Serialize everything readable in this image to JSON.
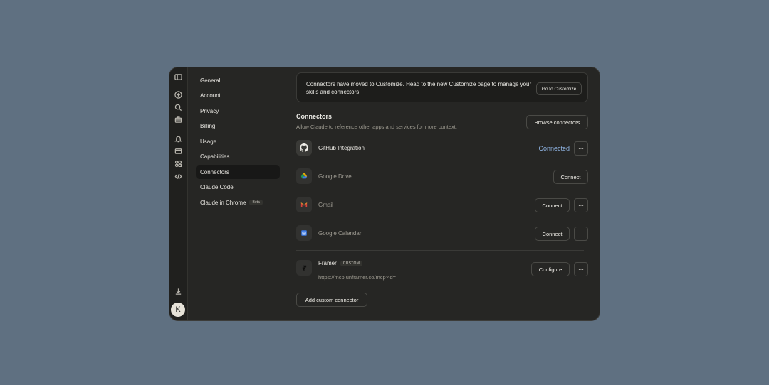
{
  "nav": {
    "items": [
      {
        "label": "General"
      },
      {
        "label": "Account"
      },
      {
        "label": "Privacy"
      },
      {
        "label": "Billing"
      },
      {
        "label": "Usage"
      },
      {
        "label": "Capabilities"
      },
      {
        "label": "Connectors"
      },
      {
        "label": "Claude Code"
      },
      {
        "label": "Claude in Chrome",
        "badge": "Beta"
      }
    ],
    "active": "Connectors"
  },
  "rail": {
    "icons": [
      "sidebar-toggle-icon",
      "new-chat-icon",
      "search-icon",
      "briefcase-icon",
      "bell-icon",
      "archive-icon",
      "apps-icon",
      "code-icon",
      "download-icon"
    ],
    "avatar_initial": "K"
  },
  "notice": {
    "text": "Connectors have moved to Customize. Head to the new Customize page to manage your skills and connectors.",
    "button": "Go to Customize"
  },
  "connectors": {
    "title": "Connectors",
    "subtitle": "Allow Claude to reference other apps and services for more context.",
    "browse_label": "Browse connectors",
    "items": [
      {
        "name": "GitHub Integration",
        "status": "Connected",
        "icon": "github-icon"
      },
      {
        "name": "Google Drive",
        "action": "Connect",
        "icon": "google-drive-icon"
      },
      {
        "name": "Gmail",
        "action": "Connect",
        "icon": "gmail-icon"
      },
      {
        "name": "Google Calendar",
        "action": "Connect",
        "icon": "google-calendar-icon"
      }
    ],
    "custom": {
      "name": "Framer",
      "badge": "CUSTOM",
      "url": "https://mcp.unframer.co/mcp?id=",
      "action": "Configure",
      "icon": "framer-icon"
    },
    "add_custom_label": "Add custom connector",
    "more_glyph": "···"
  }
}
